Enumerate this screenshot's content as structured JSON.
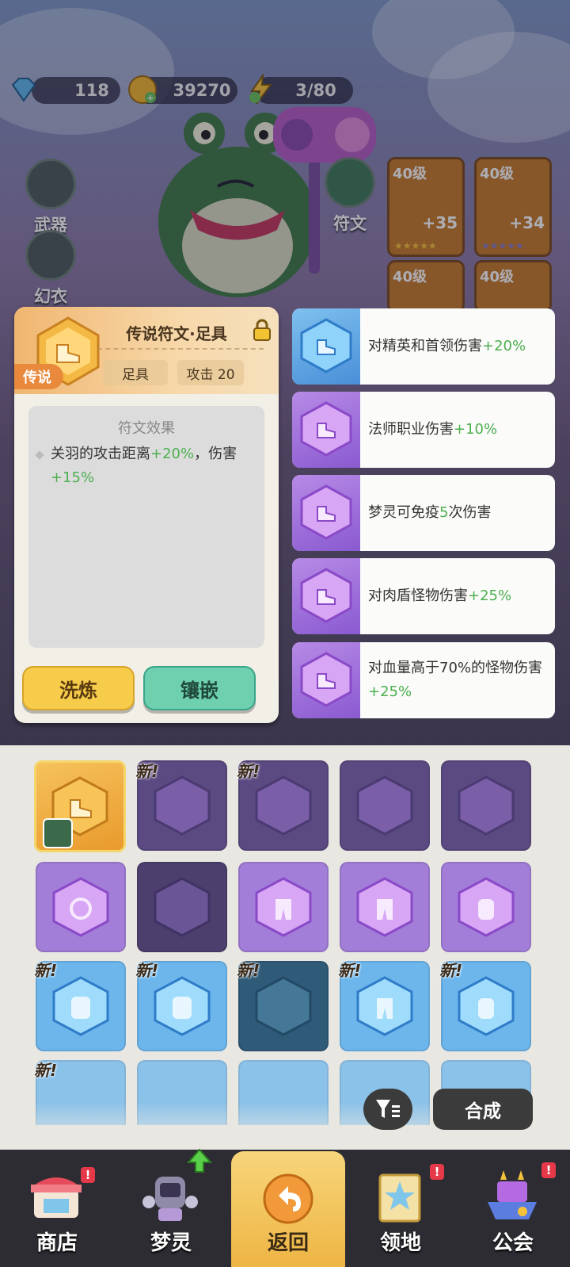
{
  "resources": [
    {
      "name": "diamond",
      "value": "118"
    },
    {
      "name": "gold-coin",
      "value": "39270"
    },
    {
      "name": "energy",
      "value": "3/80"
    }
  ],
  "side_buttons": {
    "weapon": "武器",
    "skin": "幻衣",
    "rune": "符文"
  },
  "equipment": [
    {
      "level": "40级",
      "bonus": "+35"
    },
    {
      "level": "40级",
      "bonus": "+34"
    },
    {
      "level": "40级",
      "bonus": ""
    },
    {
      "level": "40级",
      "bonus": ""
    }
  ],
  "card": {
    "title": "传说符文·足具",
    "rarity": "传说",
    "slot": "足具",
    "stat": "攻击 20",
    "effect_title": "符文效果",
    "effect_parts": [
      "关羽的攻击距离",
      "+20%",
      "，伤害",
      "+15%"
    ],
    "reforge_button": "洗炼",
    "embed_button": "镶嵌"
  },
  "rune_list": [
    {
      "text": "对精英和首领伤害",
      "value": "+20%",
      "tier": "blue"
    },
    {
      "text": "法师职业伤害",
      "value": "+10%",
      "tier": "purple"
    },
    {
      "text_before": "梦灵可免疫",
      "value": "5",
      "text_after": "次伤害",
      "tier": "purple"
    },
    {
      "text": "对肉盾怪物伤害",
      "value": "+25%",
      "tier": "purple"
    },
    {
      "text": "对血量高于70%的怪物伤害",
      "value": "+25%",
      "tier": "purple"
    }
  ],
  "new_label": "新!",
  "merge_button": "合成",
  "nav": [
    {
      "label": "商店",
      "badge": "!"
    },
    {
      "label": "梦灵",
      "badge": ""
    },
    {
      "label": "返回",
      "badge": ""
    },
    {
      "label": "领地",
      "badge": "!"
    },
    {
      "label": "公会",
      "badge": "!"
    }
  ],
  "colors": {
    "legendary": "#f0b43c",
    "epic": "#a66fe0",
    "rare": "#5aa9ec",
    "positive": "#4caf50"
  }
}
